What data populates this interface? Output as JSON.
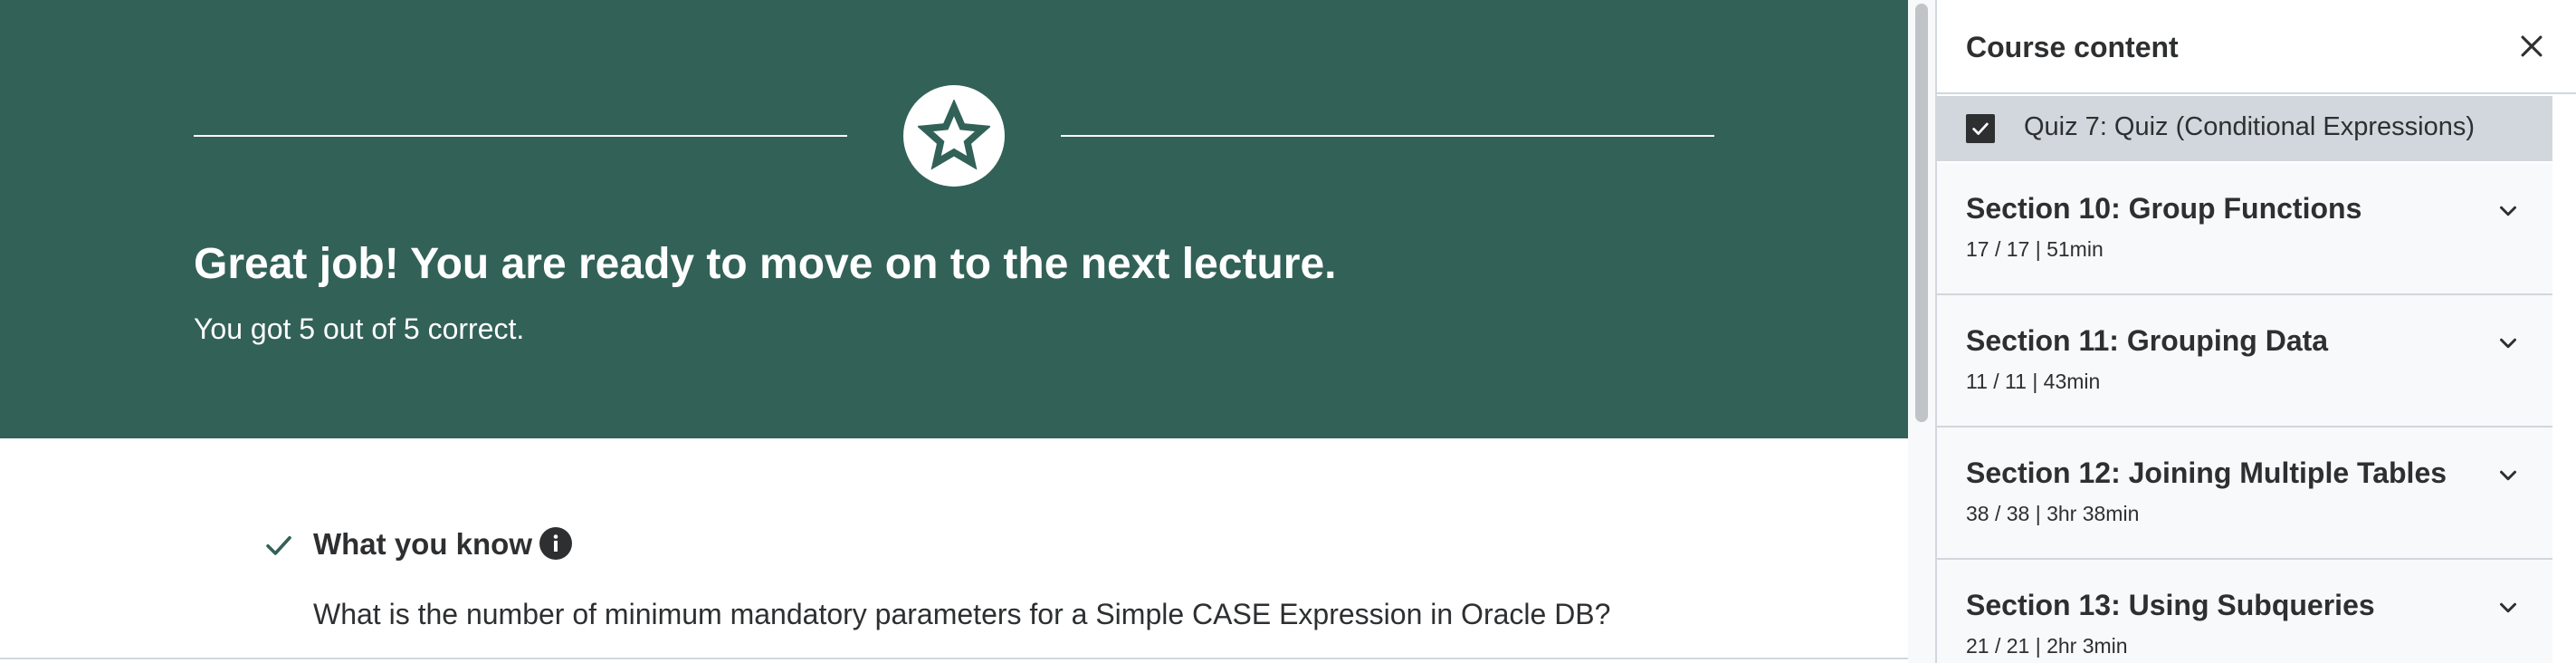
{
  "banner": {
    "title": "Great job! You are ready to move on to the next lecture.",
    "subtitle": "You got 5 out of 5 correct.",
    "color": "#326158"
  },
  "result": {
    "heading": "What you know",
    "question": "What is the number of minimum mandatory parameters for a Simple CASE Expression in Oracle DB?"
  },
  "sidebar": {
    "title": "Course content",
    "current_item": {
      "label": "Quiz 7: Quiz (Conditional Expressions)",
      "checked": true
    },
    "sections": [
      {
        "title": "Section 10: Group Functions",
        "meta": "17 / 17 | 51min"
      },
      {
        "title": "Section 11: Grouping Data",
        "meta": "11 / 11 | 43min"
      },
      {
        "title": "Section 12: Joining Multiple Tables",
        "meta": "38 / 38 | 3hr 38min"
      },
      {
        "title": "Section 13: Using Subqueries",
        "meta": "21 / 21 | 2hr 3min"
      }
    ]
  },
  "icons": {
    "badge": "star-icon",
    "status": "check-icon",
    "info": "info-icon",
    "close": "close-icon",
    "expand": "chevron-down-icon"
  }
}
